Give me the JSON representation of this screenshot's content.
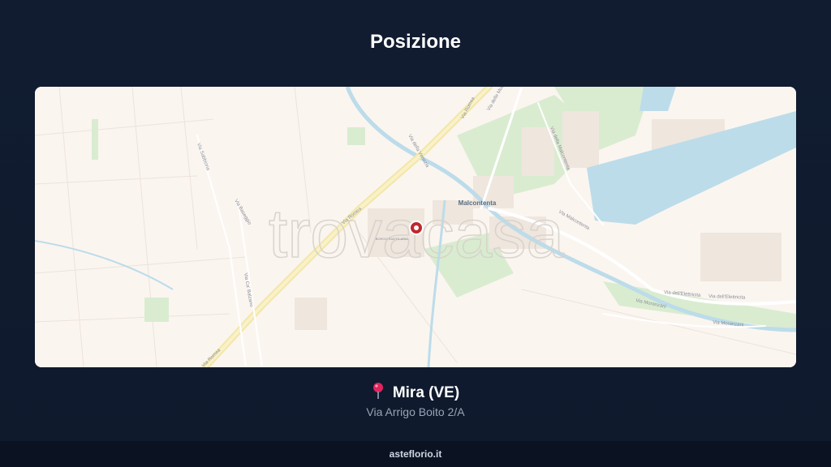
{
  "header": {
    "title": "Posizione"
  },
  "map": {
    "place_label": "Malcontenta",
    "area_label": "BORGO SANT'ILARIO",
    "watermark": "trovacasa",
    "street_labels": {
      "romea_north": "Via Romea",
      "romea_mid": "Via Romea",
      "romea_south": "Via Romea",
      "venezia": "Via della Venezia",
      "fusina": "Via delle Motte",
      "moranzani_1": "Via Moranzani",
      "moranzani_2": "Via Moranzani",
      "elettricita_1": "Via dell'Elettricita",
      "elettricita_2": "Via dell'Elettricita",
      "malcontenta": "Via della Malcontenta",
      "sabbiona": "Via Sabbiona",
      "cabalzano": "Via Ca' Balzano",
      "baseggio": "Via Baseggio",
      "marghera": "Via Malcontenta",
      "boito": "Via Arrigo Boito"
    },
    "colors": {
      "background": "#fbf5f0",
      "water": "#bcdcea",
      "park": "#d9ecd0",
      "road_main": "#f4e9a8",
      "marker": "#c0272d"
    }
  },
  "location": {
    "pin_icon": "round-pushpin",
    "city": "Mira (VE)",
    "address": "Via Arrigo Boito 2/A"
  },
  "footer": {
    "site": "asteflorio.it"
  }
}
